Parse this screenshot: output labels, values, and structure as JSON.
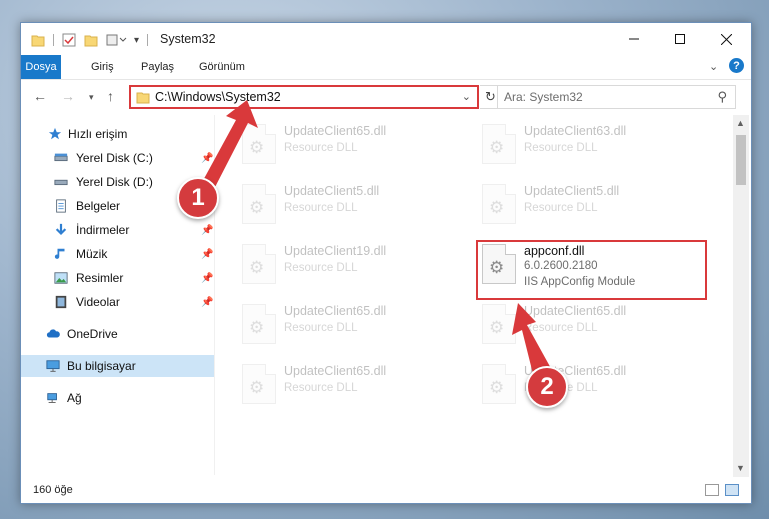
{
  "window": {
    "title": "System32"
  },
  "ribbon": {
    "tabs": [
      "Dosya",
      "Giriş",
      "Paylaş",
      "Görünüm"
    ]
  },
  "address": {
    "path": "C:\\Windows\\System32",
    "search_placeholder": "Ara: System32"
  },
  "sidebar": {
    "items": [
      {
        "label": "Hızlı erişim",
        "icon": "star-icon",
        "pinned": false
      },
      {
        "label": "Yerel Disk (C:)",
        "icon": "drive-icon",
        "pinned": true
      },
      {
        "label": "Yerel Disk (D:)",
        "icon": "drive-icon",
        "pinned": false
      },
      {
        "label": "Belgeler",
        "icon": "documents-icon",
        "pinned": true
      },
      {
        "label": "İndirmeler",
        "icon": "download-icon",
        "pinned": true
      },
      {
        "label": "Müzik",
        "icon": "music-icon",
        "pinned": true
      },
      {
        "label": "Resimler",
        "icon": "pictures-icon",
        "pinned": true
      },
      {
        "label": "Videolar",
        "icon": "videos-icon",
        "pinned": true
      },
      {
        "label": "OneDrive",
        "icon": "cloud-icon",
        "pinned": false
      },
      {
        "label": "Bu bilgisayar",
        "icon": "computer-icon",
        "pinned": false,
        "selected": true
      },
      {
        "label": "Ağ",
        "icon": "network-icon",
        "pinned": false
      }
    ]
  },
  "files": [
    {
      "name": "UpdateClient65.dll",
      "desc": "Resource DLL",
      "faded": true
    },
    {
      "name": "UpdateClient63.dll",
      "desc": "Resource DLL",
      "faded": true
    },
    {
      "name": "UpdateClient5.dll",
      "desc": "Resource DLL",
      "faded": true
    },
    {
      "name": "UpdateClient5.dll",
      "desc": "Resource DLL",
      "faded": true
    },
    {
      "name": "UpdateClient19.dll",
      "desc": "Resource DLL",
      "faded": true
    },
    {
      "name": "appconf.dll",
      "desc": "6.0.2600.2180",
      "desc2": "IIS AppConfig Module",
      "faded": false
    },
    {
      "name": "UpdateClient65.dll",
      "desc": "Resource DLL",
      "faded": true
    },
    {
      "name": "UpdateClient65.dll",
      "desc": "Resource DLL",
      "faded": true
    },
    {
      "name": "UpdateClient65.dll",
      "desc": "Resource DLL",
      "faded": true
    },
    {
      "name": "UpdateClient65.dll",
      "desc": "Resource DLL",
      "faded": true
    }
  ],
  "status": {
    "count": "160 öğe"
  },
  "annotations": {
    "step1": "1",
    "step2": "2",
    "color": "#d9393b"
  }
}
